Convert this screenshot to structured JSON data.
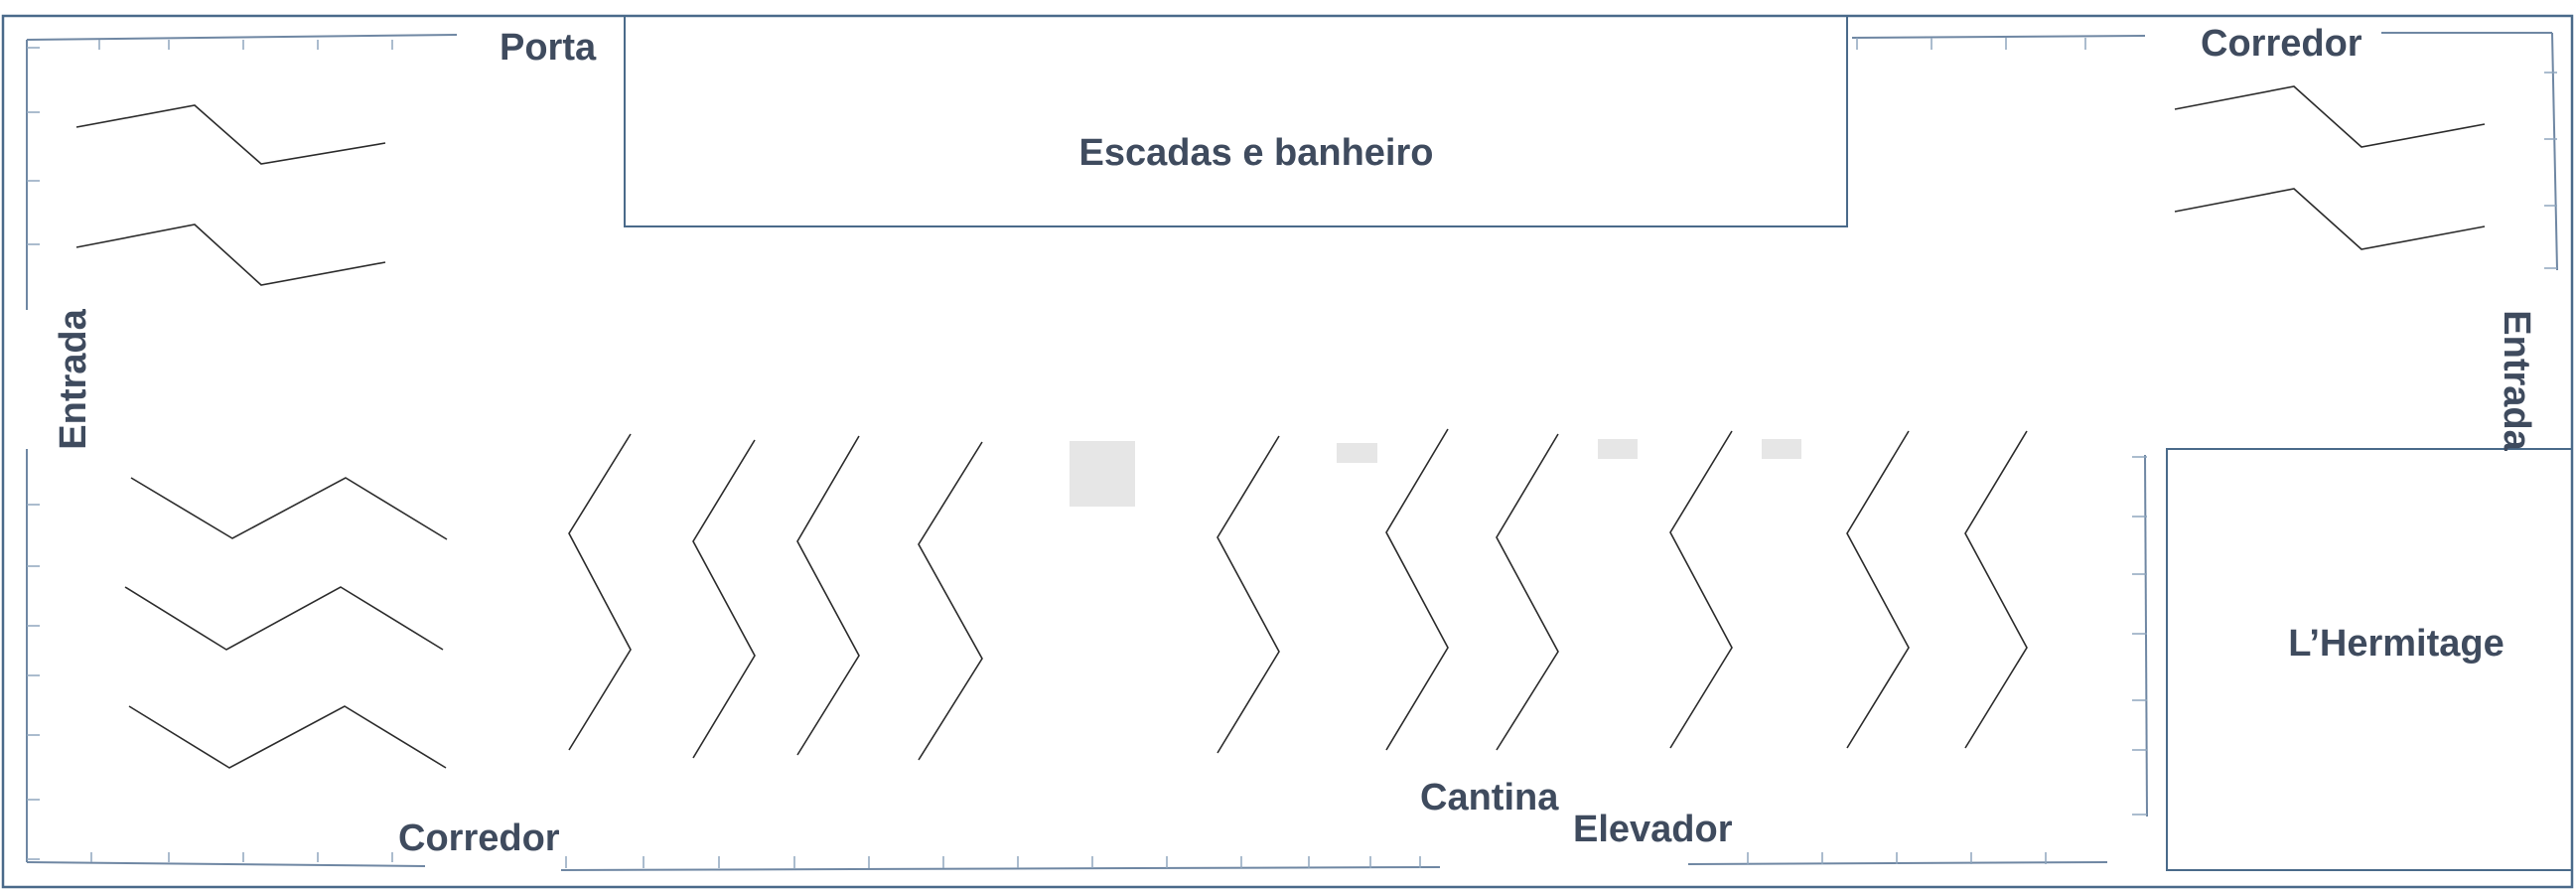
{
  "labels": {
    "porta": "Porta",
    "escadas": "Escadas e banheiro",
    "corredor_top": "Corredor",
    "entrada_left": "Entrada",
    "entrada_right": "Entrada",
    "corredor_bottom": "Corredor",
    "cantina": "Cantina",
    "elevador": "Elevador",
    "hermitage": "L’Hermitage"
  },
  "colors": {
    "label": "#3f4b5e",
    "outline": "#4a6a8a",
    "wall": "#6f87a3",
    "furniture": "#2b2b2b",
    "block": "#e6e6e6"
  }
}
